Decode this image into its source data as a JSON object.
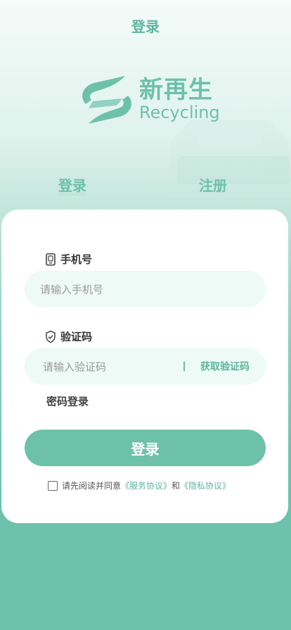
{
  "header": {
    "title": "登录"
  },
  "logo": {
    "cn": "新再生",
    "en": "Recycling",
    "icon": "recycle-s-logo-icon"
  },
  "tabs": [
    {
      "label": "登录",
      "active": true
    },
    {
      "label": "注册",
      "active": false
    }
  ],
  "form": {
    "phone": {
      "label": "手机号",
      "placeholder": "请输入手机号",
      "value": "",
      "icon": "phone-icon"
    },
    "code": {
      "label": "验证码",
      "placeholder": "请输入验证码",
      "value": "",
      "icon": "shield-check-icon",
      "get_code_label": "获取验证码"
    },
    "password_login": "密码登录",
    "submit_label": "登录"
  },
  "agreement": {
    "prefix": "请先阅读并同意",
    "service": "《服务协议》",
    "and": "和",
    "privacy": "《隐私协议》",
    "checked": false
  },
  "colors": {
    "accent": "#6dc1a9",
    "input_bg": "#edfaf6",
    "card": "#ffffff"
  }
}
